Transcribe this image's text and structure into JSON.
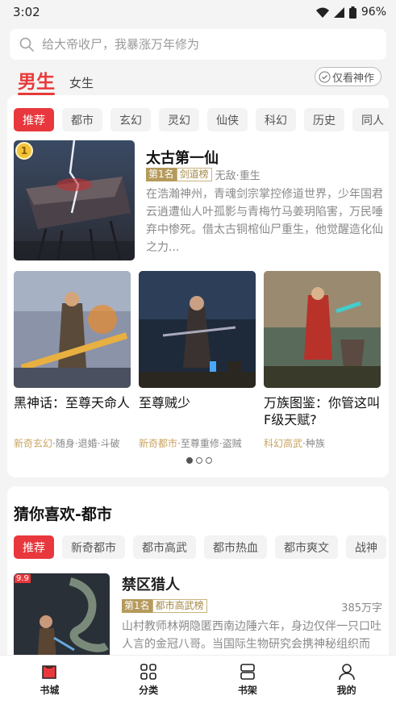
{
  "status": {
    "time": "3:02",
    "battery": "96%"
  },
  "search": {
    "placeholder": "给大帝收尸，我暴涨万年修为"
  },
  "gender_tabs": {
    "male": "男生",
    "female": "女生"
  },
  "only_god": "仅看神作",
  "categories": [
    "推荐",
    "都市",
    "玄幻",
    "灵幻",
    "仙侠",
    "科幻",
    "历史",
    "同人"
  ],
  "featured": {
    "rank_number": "1",
    "title": "太古第一仙",
    "rank_label": "第1名",
    "rank_list": "剑道榜",
    "tags": "无敌·重生",
    "description": "在浩瀚神州，青魂剑宗掌控修道世界，少年国君云逍遭仙人叶孤影与青梅竹马姜玥陷害，万民唾弃中惨死。借太古铜棺仙尸重生，他觉醒造化仙之力..."
  },
  "books": [
    {
      "title": "黑神话：至尊天命人",
      "category": "新奇玄幻",
      "tags": "·随身·退婚·斗破"
    },
    {
      "title": "至尊贼少",
      "category": "新奇都市",
      "tags": "·至尊重修·盗贼"
    },
    {
      "title": "万族图鉴：你管这叫F级天赋?",
      "category": "科幻高武",
      "tags": "·种族"
    }
  ],
  "guess": {
    "title": "猜你喜欢-都市",
    "chips": [
      "推荐",
      "新奇都市",
      "都市高武",
      "都市热血",
      "都市爽文",
      "战神"
    ],
    "book": {
      "score": "9.9",
      "title": "禁区猎人",
      "rank_label": "第1名",
      "rank_list": "都市高武榜",
      "words": "385万字",
      "description": "山村教师林朔隐匿西南边陲六年，身边仅伴一只口吐人言的金冠八哥。当国际生物研究会携神秘组织而来..."
    }
  },
  "nav": [
    "书城",
    "分类",
    "书架",
    "我的"
  ],
  "colors": {
    "accent": "#e8383d",
    "gold": "#b59a5c"
  }
}
